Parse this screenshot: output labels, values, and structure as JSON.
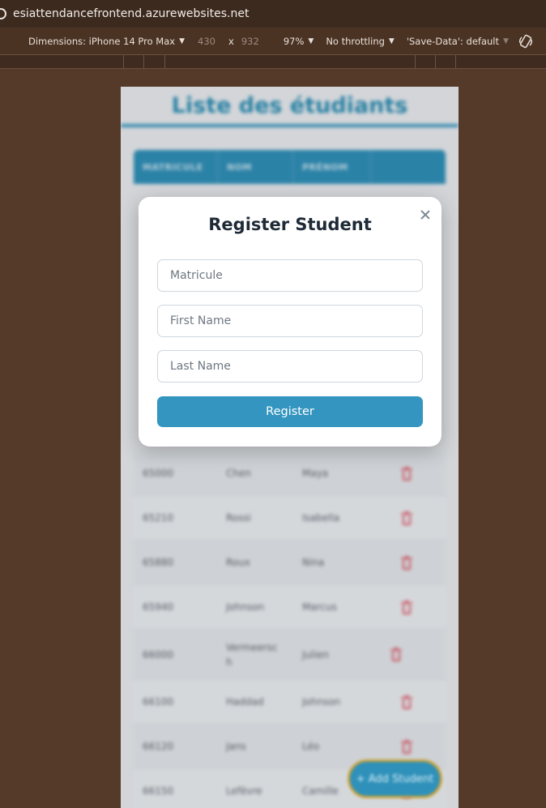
{
  "browser": {
    "url": "esiattendancefrontend.azurewebsites.net"
  },
  "devtools": {
    "dimensions_label": "Dimensions: iPhone 14 Pro Max",
    "width": "430",
    "times": "x",
    "height": "932",
    "zoom": "97%",
    "throttling": "No throttling",
    "save_data": "'Save-Data': default"
  },
  "page": {
    "title": "Liste des étudiants",
    "columns": [
      "MATRICULE",
      "NOM",
      "PRÉNOM"
    ],
    "rows": [
      {
        "matricule": "65000",
        "nom": "Chen",
        "prenom": "Maya"
      },
      {
        "matricule": "65210",
        "nom": "Rossi",
        "prenom": "Isabella"
      },
      {
        "matricule": "65880",
        "nom": "Roux",
        "prenom": "Nina"
      },
      {
        "matricule": "65940",
        "nom": "Johnson",
        "prenom": "Marcus"
      },
      {
        "matricule": "66000",
        "nom": "Vermeersc h",
        "prenom": "Julien"
      },
      {
        "matricule": "66100",
        "nom": "Haddad",
        "prenom": "Johnson"
      },
      {
        "matricule": "66120",
        "nom": "Jans",
        "prenom": "Léo"
      },
      {
        "matricule": "66150",
        "nom": "Lefèvre",
        "prenom": "Camille"
      }
    ],
    "add_button": "+ Add Student"
  },
  "modal": {
    "title": "Register Student",
    "matricule_placeholder": "Matricule",
    "first_name_placeholder": "First Name",
    "last_name_placeholder": "Last Name",
    "submit_label": "Register"
  },
  "colors": {
    "accent": "#3496c0",
    "danger": "#e05264",
    "chrome": "#553a29"
  }
}
